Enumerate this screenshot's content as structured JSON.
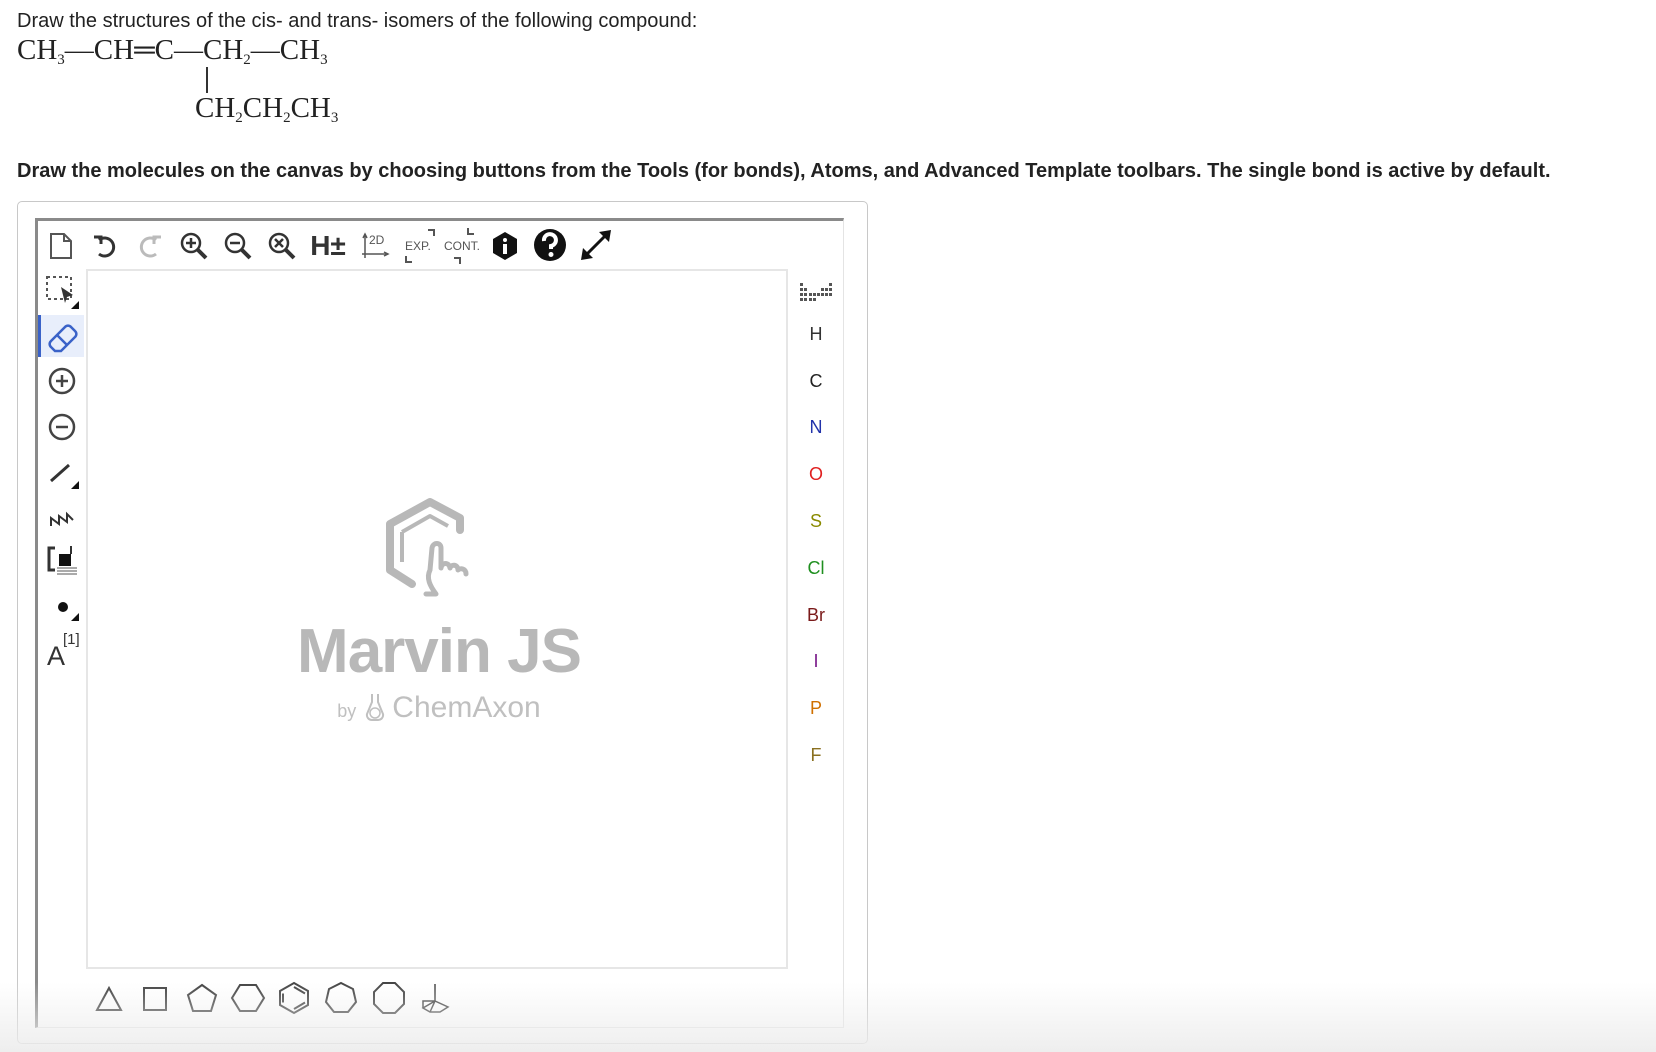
{
  "question": {
    "prompt": "Draw the structures of the cis- and trans- isomers of the following compound:",
    "formula": {
      "ch3_a": "CH",
      "sub_3": "3",
      "dash_1": "—",
      "ch": "CH",
      "double_bond": "═",
      "c": "C",
      "dash_2": "—",
      "ch2": "CH",
      "sub_2": "2",
      "dash_3": "—",
      "ch3_b": "CH",
      "branch": {
        "ch_a": "CH",
        "sub_a": "2",
        "ch_b": "CH",
        "sub_b": "2",
        "ch_c": "CH",
        "sub_c": "3"
      }
    },
    "instructions": "Draw the molecules on the canvas by choosing buttons from the Tools (for bonds), Atoms, and Advanced Template toolbars. The single bond is active by default."
  },
  "editor": {
    "top_toolbar": {
      "hydrogen_label": "H±",
      "clean_2d_label": "2D",
      "expand_label": "EXP.",
      "contract_label": "CONT."
    },
    "left_toolbar": {
      "atom_map_label": "A",
      "atom_map_number": "[1]"
    },
    "watermark": {
      "brand": "Marvin JS",
      "by": "by",
      "company": "ChemAxon"
    },
    "atoms": [
      {
        "symbol": "H",
        "color": "#333333"
      },
      {
        "symbol": "C",
        "color": "#222222"
      },
      {
        "symbol": "N",
        "color": "#2233aa"
      },
      {
        "symbol": "O",
        "color": "#e02020"
      },
      {
        "symbol": "S",
        "color": "#8a8a00"
      },
      {
        "symbol": "Cl",
        "color": "#1f8f1f"
      },
      {
        "symbol": "Br",
        "color": "#7a1a1a"
      },
      {
        "symbol": "I",
        "color": "#7a1a8a"
      },
      {
        "symbol": "P",
        "color": "#d07000"
      },
      {
        "symbol": "F",
        "color": "#8a7020"
      }
    ],
    "colors": {
      "active_tool_accent": "#3a62c8",
      "canvas_border": "#e6e6e6",
      "watermark": "#b8b8b8"
    }
  }
}
